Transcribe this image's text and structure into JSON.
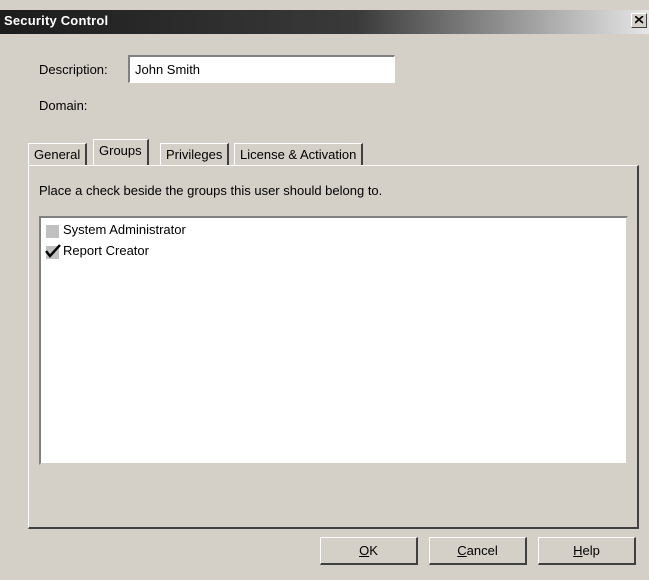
{
  "window": {
    "title": "Security Control"
  },
  "form": {
    "description_label": "Description:",
    "description_value": "John Smith",
    "domain_label": "Domain:"
  },
  "tabs": [
    {
      "label": "General",
      "active": false
    },
    {
      "label": "Groups",
      "active": true
    },
    {
      "label": "Privileges",
      "active": false
    },
    {
      "label": "License & Activation",
      "active": false
    }
  ],
  "groups_tab": {
    "instruction": "Place a check beside the groups this user should belong to.",
    "groups": [
      {
        "label": "System Administrator",
        "checked": false
      },
      {
        "label": "Report Creator",
        "checked": true
      }
    ]
  },
  "buttons": {
    "ok": {
      "mnemonic": "O",
      "rest": "K"
    },
    "cancel": {
      "mnemonic": "C",
      "rest": "ancel"
    },
    "help": {
      "mnemonic": "H",
      "rest": "elp"
    }
  },
  "colors": {
    "dialog_bg": "#d4d0c8",
    "title_bar": "#1c1c1c",
    "checkbox_gray": "#c0c0c0"
  },
  "icons": {
    "close": "close-icon",
    "check": "checkmark-icon"
  }
}
